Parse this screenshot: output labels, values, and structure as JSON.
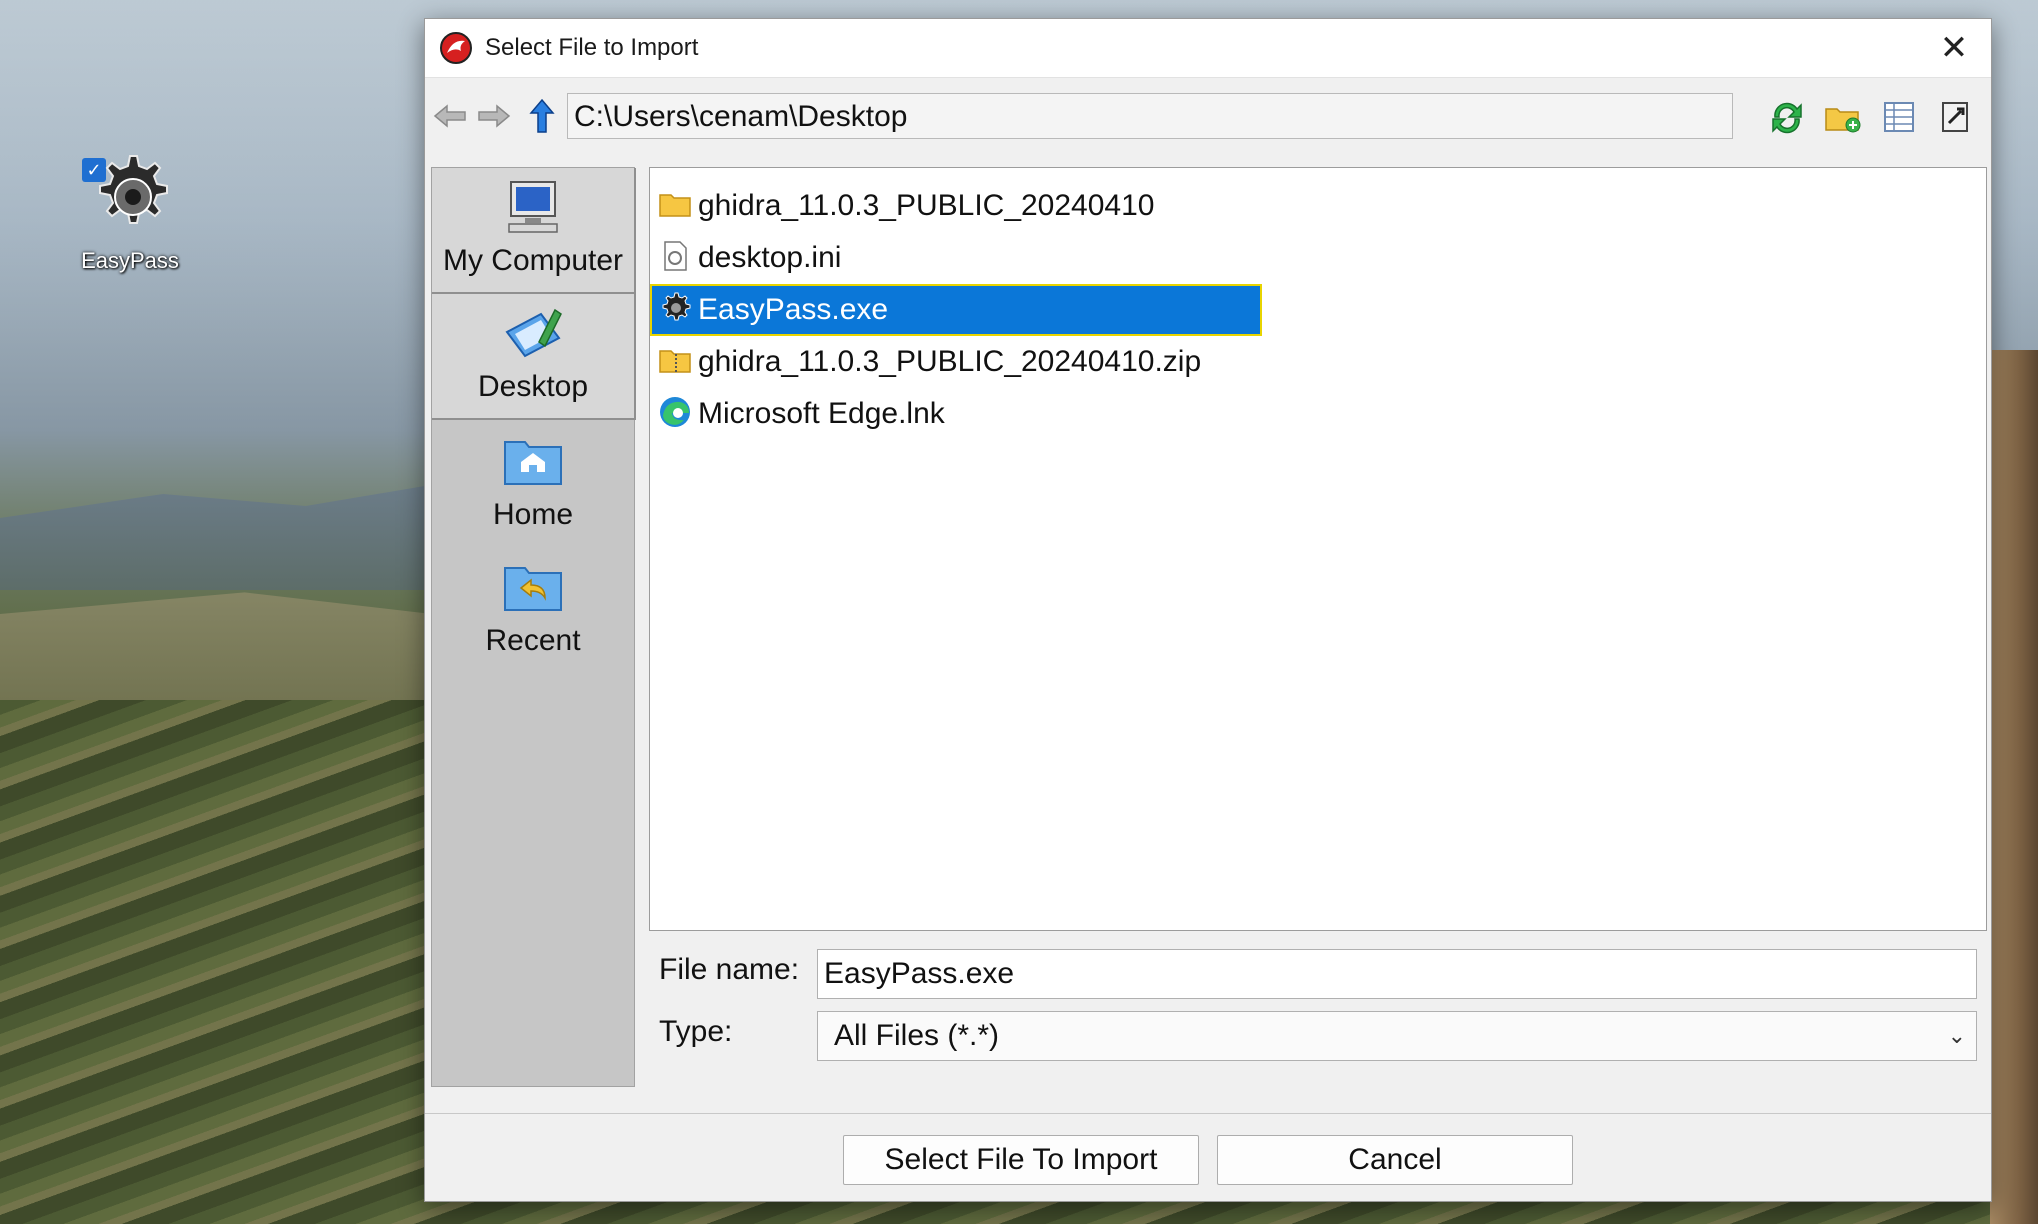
{
  "desktop": {
    "icon_label": "EasyPass"
  },
  "dialog": {
    "title": "Select File to Import",
    "close_glyph": "✕"
  },
  "toolbar": {
    "back_icon": "back-arrow-icon",
    "forward_icon": "forward-arrow-icon",
    "up_icon": "up-arrow-icon",
    "path": "C:\\Users\\cenam\\Desktop",
    "refresh_icon": "refresh-icon",
    "new_folder_icon": "new-folder-icon",
    "details_view_icon": "details-view-icon",
    "properties_icon": "properties-icon"
  },
  "sidebar": {
    "items": [
      {
        "label": "My Computer",
        "icon": "computer-icon"
      },
      {
        "label": "Desktop",
        "icon": "desktop-icon"
      },
      {
        "label": "Home",
        "icon": "home-folder-icon"
      },
      {
        "label": "Recent",
        "icon": "recent-folder-icon"
      }
    ]
  },
  "files": [
    {
      "name": "ghidra_11.0.3_PUBLIC_20240410",
      "icon": "folder-icon",
      "selected": false
    },
    {
      "name": "desktop.ini",
      "icon": "settings-file-icon",
      "selected": false
    },
    {
      "name": "EasyPass.exe",
      "icon": "gear-icon",
      "selected": true
    },
    {
      "name": "ghidra_11.0.3_PUBLIC_20240410.zip",
      "icon": "zip-folder-icon",
      "selected": false
    },
    {
      "name": "Microsoft Edge.lnk",
      "icon": "edge-icon",
      "selected": false
    }
  ],
  "form": {
    "file_name_label": "File name:",
    "file_name_value": "EasyPass.exe",
    "type_label": "Type:",
    "type_value": "All Files (*.*)"
  },
  "buttons": {
    "select": "Select File To Import",
    "cancel": "Cancel"
  },
  "colors": {
    "selection": "#0b77d8",
    "selection_outline": "#e8d400",
    "dialog_bg": "#f0f0f0",
    "sidebar_bg": "#c6c6c6"
  }
}
